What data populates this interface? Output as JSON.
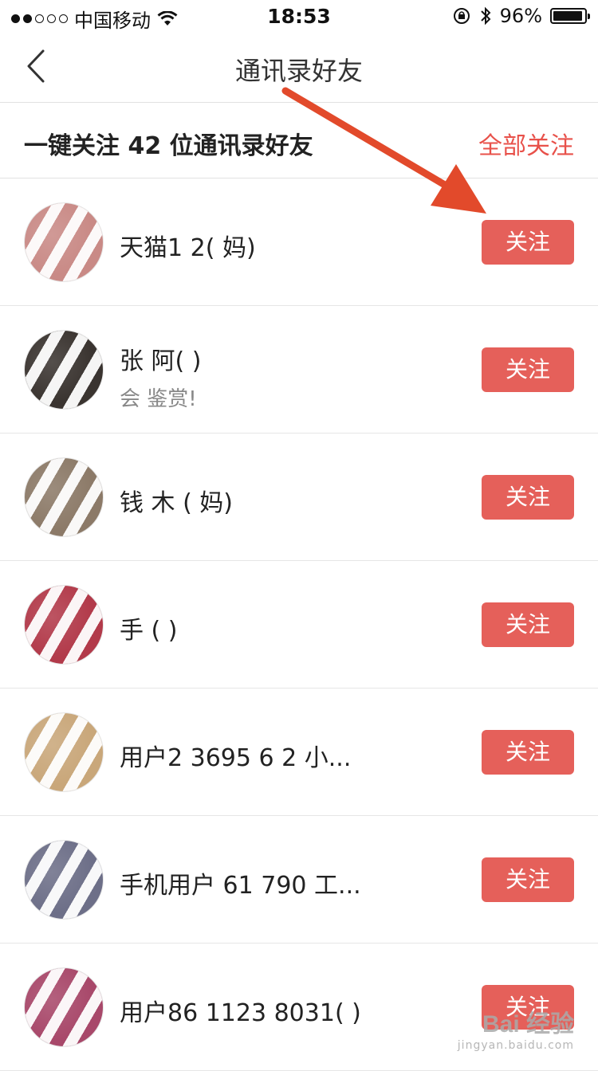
{
  "status_bar": {
    "carrier": "中国移动",
    "time": "18:53",
    "battery_percent": "96%",
    "battery_level": 0.96,
    "signal_strength": 2,
    "signal_max": 5
  },
  "nav": {
    "title": "通讯录好友"
  },
  "follow_all": {
    "text": "一键关注 42 位通讯录好友",
    "button_label": "全部关注"
  },
  "contacts": [
    {
      "name": "天猫1 2( 妈)",
      "subtitle": "",
      "button": "关注",
      "avatar_color": "#c98a86"
    },
    {
      "name": "张 阿(  )",
      "subtitle": "会   鉴赏!",
      "button": "关注",
      "avatar_color": "#3a3430"
    },
    {
      "name": "钱 木 ( 妈)",
      "subtitle": "",
      "button": "关注",
      "avatar_color": "#8c7a68"
    },
    {
      "name": "  手   (   )",
      "subtitle": "",
      "button": "关注",
      "avatar_color": "#b23a4a"
    },
    {
      "name": "用户2  3695 6 2   小...",
      "subtitle": "",
      "button": "关注",
      "avatar_color": "#c9a77a"
    },
    {
      "name": "手机用户    61  790 工...",
      "subtitle": "",
      "button": "关注",
      "avatar_color": "#6d6f88"
    },
    {
      "name": "用户86 1123  8031(  )",
      "subtitle": "",
      "button": "关注",
      "avatar_color": "#a8486a"
    }
  ],
  "watermark": {
    "logo_text": "Bai 经验",
    "url": "jingyan.baidu.com"
  },
  "colors": {
    "accent": "#e8514a",
    "button_bg": "#e5605a",
    "arrow": "#e24a2b"
  }
}
